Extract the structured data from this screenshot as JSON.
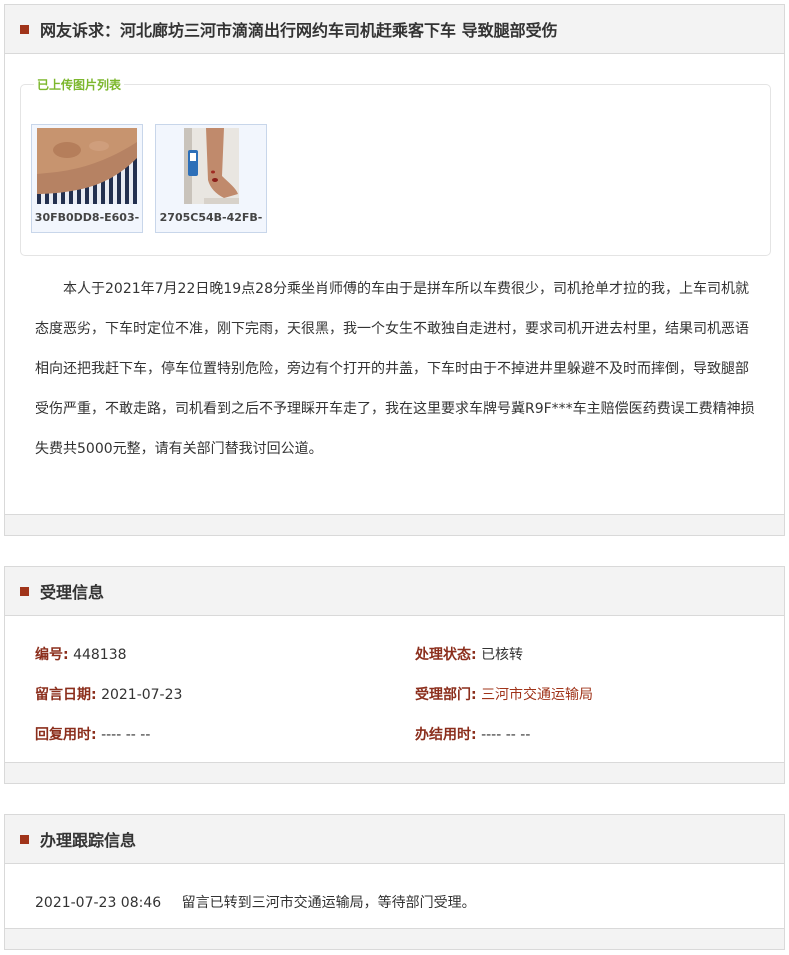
{
  "complaint": {
    "title": "网友诉求：河北廊坊三河市滴滴出行网约车司机赶乘客下车 导致腿部受伤",
    "uploads_legend": "已上传图片列表",
    "images": [
      {
        "caption": "30FB0DD8-E603-",
        "icon": "arm-skin-photo"
      },
      {
        "caption": "2705C54B-42FB-",
        "icon": "leg-injury-photo"
      }
    ],
    "body": "本人于2021年7月22日晚19点28分乘坐肖师傅的车由于是拼车所以车费很少，司机抢单才拉的我，上车司机就态度恶劣，下车时定位不准，刚下完雨，天很黑，我一个女生不敢独自走进村，要求司机开进去村里，结果司机恶语相向还把我赶下车，停车位置特别危险，旁边有个打开的井盖，下车时由于不掉进井里躲避不及时而摔倒，导致腿部受伤严重，不敢走路，司机看到之后不予理睬开车走了，我在这里要求车牌号冀R9F***车主赔偿医药费误工费精神损失费共5000元整，请有关部门替我讨回公道。"
  },
  "info": {
    "title": "受理信息",
    "number_label": "编号:",
    "number": "448138",
    "status_label": "处理状态:",
    "status": "已核转",
    "date_label": "留言日期:",
    "date": "2021-07-23",
    "dept_label": "受理部门:",
    "dept": "三河市交通运输局",
    "reply_label": "回复用时:",
    "reply": "---- -- --",
    "done_label": "办结用时:",
    "done": "---- -- --"
  },
  "tracking": {
    "title": "办理跟踪信息",
    "entries": [
      {
        "time": "2021-07-23 08:46",
        "text": "留言已转到三河市交通运输局，等待部门受理。"
      }
    ]
  },
  "colors": {
    "accent": "#a0341a",
    "label": "#8b2e1c",
    "legend": "#7cb72d"
  }
}
